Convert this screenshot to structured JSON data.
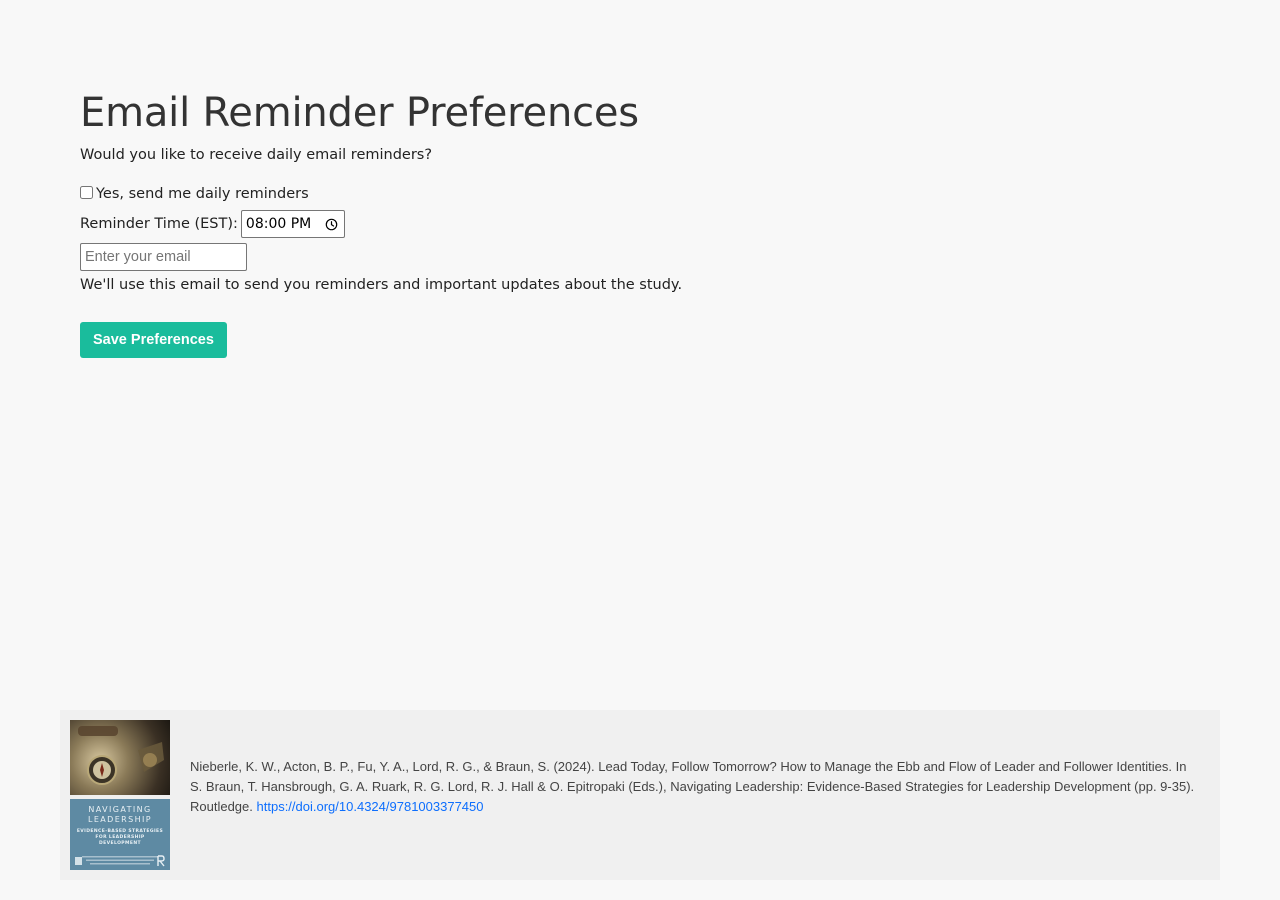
{
  "page": {
    "title": "Email Reminder Preferences",
    "question": "Would you like to receive daily email reminders?"
  },
  "form": {
    "checkbox_label": "Yes, send me daily reminders",
    "checkbox_checked": false,
    "time_label": "Reminder Time (EST):",
    "time_value": "08:00 PM",
    "email_placeholder": "Enter your email",
    "email_value": "",
    "help_text": "We'll use this email to send you reminders and important updates about the study.",
    "save_label": "Save Preferences"
  },
  "footer": {
    "citation": "Nieberle, K. W., Acton, B. P., Fu, Y. A., Lord, R. G., & Braun, S. (2024). Lead Today, Follow Tomorrow? How to Manage the Ebb and Flow of Leader and Follower Identities. In S. Braun, T. Hansbrough, G. A. Ruark, R. G. Lord, R. J. Hall & O. Epitropaki (Eds.), Navigating Leadership: Evidence-Based Strategies for Leadership Development (pp. 9-35). Routledge.",
    "doi_text": "https://doi.org/10.4324/9781003377450",
    "book_cover": {
      "title": "NAVIGATING LEADERSHIP",
      "subtitle": "EVIDENCE-BASED STRATEGIES FOR LEADERSHIP DEVELOPMENT"
    }
  },
  "colors": {
    "accent": "#1abc9c",
    "link": "#0d6efd",
    "background": "#f8f8f8",
    "footer_background": "#f0f0f0"
  }
}
